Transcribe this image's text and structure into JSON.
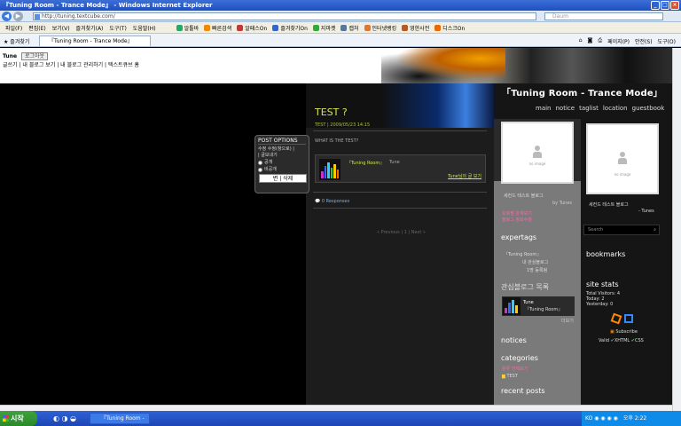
{
  "window": {
    "title": "『Tuning Room - Trance Mode』 - Windows Internet Explorer"
  },
  "address": {
    "url": "http://tuning.textcube.com/",
    "search_placeholder": "Daum"
  },
  "menu": {
    "items": [
      "파일(F)",
      "편집(E)",
      "보기(V)",
      "즐겨찾기(A)",
      "도구(T)",
      "도움말(H)"
    ],
    "toolbar": [
      "알툴바",
      "빠른검색",
      "알패스On",
      "즐겨찾기On",
      "지마켓",
      "캡처",
      "인터넷뱅킹",
      "영한사전",
      "디스크On"
    ]
  },
  "favbar": {
    "favorites": "즐겨찾기",
    "tab": "『Tuning Room - Trance Mode』",
    "commands": [
      "페이지(P)",
      "안전(S)",
      "도구(O)"
    ]
  },
  "blogbar": {
    "name": "Tune",
    "login": "로그아웃",
    "links": "글쓰기 | 내 블로그 보기 | 내 블로그 관리하기 | 텍스트큐브 홈"
  },
  "popup": {
    "title": "POST OPTIONS",
    "row1": "수정  수정(창으로) |",
    "row2": "| 글보내기",
    "opt_public": "공개",
    "opt_private": "비공개",
    "delete": "삭제",
    "edit_char": "변"
  },
  "post": {
    "title": "TEST ?",
    "meta": "TEST     |  2009/05/23 14:15",
    "body": "WHAT IS THE TEST?",
    "track_title": "『Tuning Room』",
    "track_user": "Tune",
    "track_link": "Tune님의 글 보기",
    "responses": "0 Responses",
    "pager": "« Previous  |  1  |  Next »"
  },
  "sidebar": {
    "brand": "「Tuning Room - Trance Mode」",
    "nav": [
      "main",
      "notice",
      "taglist",
      "location",
      "guestbook"
    ],
    "photo_caption": "no image",
    "profile1": "세컨드 테스트 블로그",
    "profile1_by": "by Tunes",
    "profile2": "세컨드 테스트 블로그",
    "profile2_by": "- Tunes",
    "links": [
      "프로필 관계보기",
      "블로그 정보수정"
    ],
    "search": "Search",
    "expertags_title": "expertags",
    "expertags": [
      "『Tuning Room』",
      "내 관심블로그",
      "1명 등록됨"
    ],
    "interest_title": "관심블로그 목록",
    "interest_user": "Tune",
    "interest_blog": "『Tuning Room』",
    "interest_more": "더보기",
    "notices": "notices",
    "categories": "categories",
    "cat_all": "분류 전체보기",
    "cat_test": "TEST",
    "recent": "recent posts",
    "bookmarks": "bookmarks",
    "stats_title": "site stats",
    "stats": [
      "Total Visitors: 4",
      "Today:  2",
      "Yesterday: 0"
    ],
    "subscribe": "Subscribe",
    "valid": "Valid",
    "xhtml": "XHTML",
    "css": "CSS"
  },
  "taskbar": {
    "start": "시작",
    "task": "『Tuning Room - ...",
    "tray_lang": "KO",
    "clock": "오후 2:22"
  }
}
